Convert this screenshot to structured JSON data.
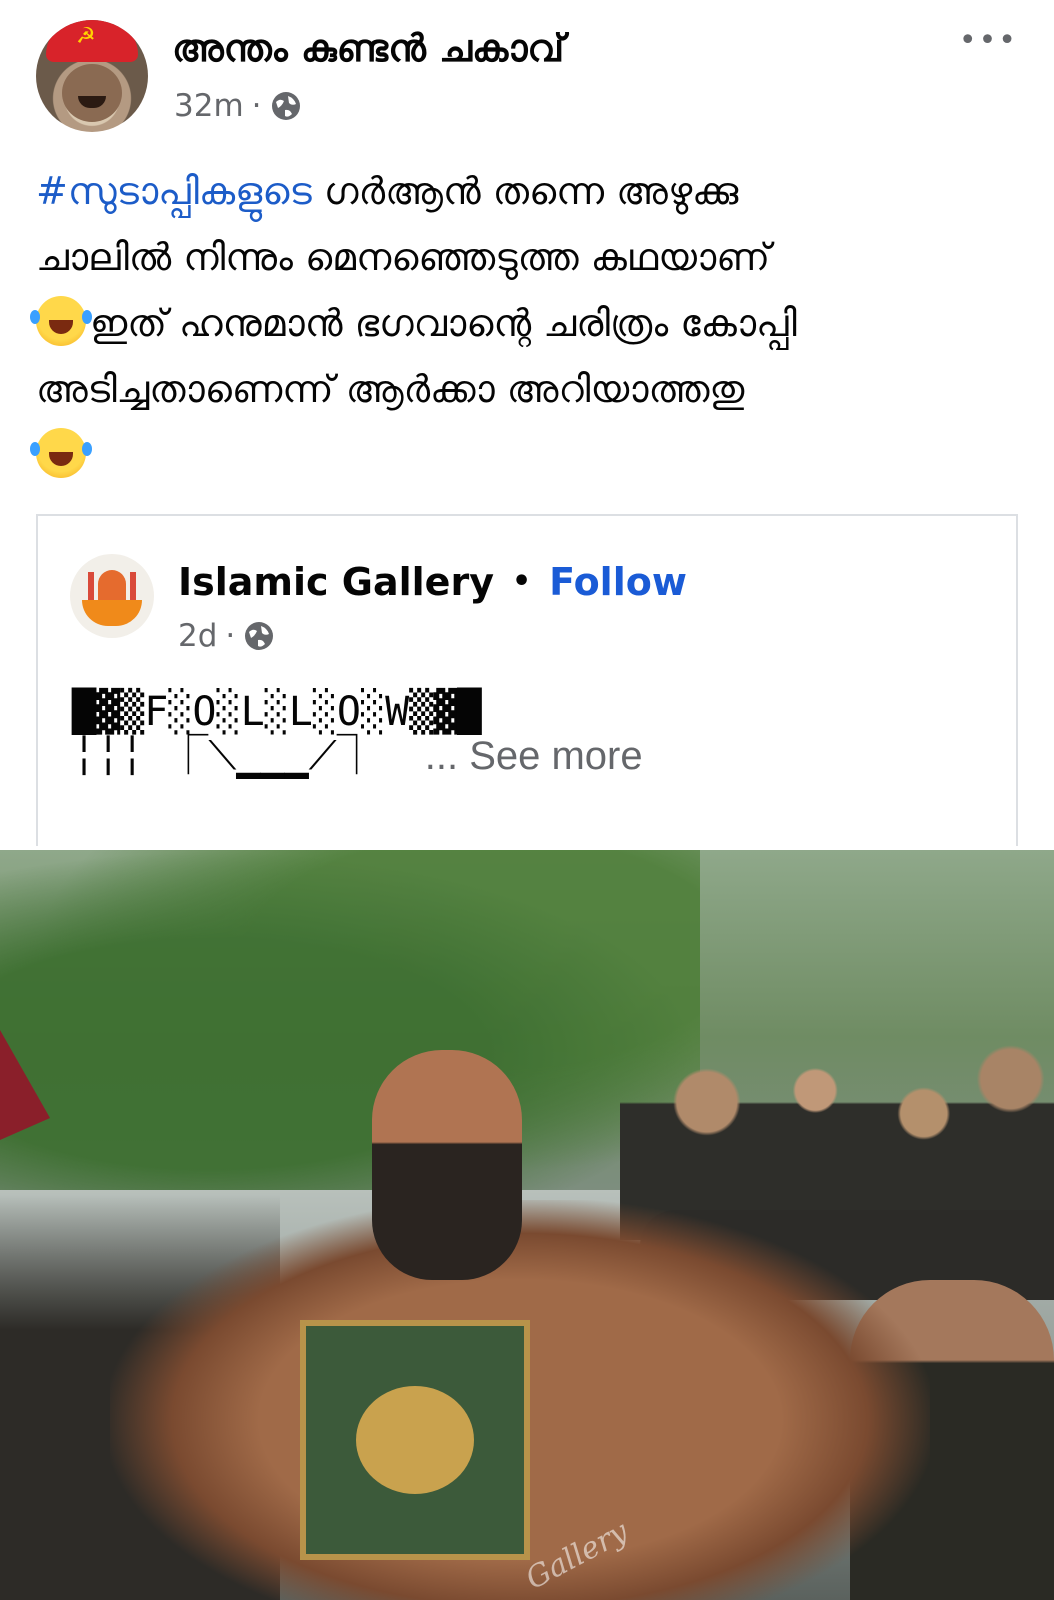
{
  "post": {
    "author": "അന്തം കുണ്ടൻ ചകാവ്",
    "time": "32m",
    "separator": "·",
    "privacy_icon": "globe-icon",
    "more_icon": "ellipsis-icon",
    "more_label": "•••",
    "text": {
      "hashtag": "#സുടാപ്പികളുടെ",
      "line1_rest": " ഗർആൻ തന്നെ അഴുക്കു",
      "line2": "ചാലിൽ നിന്നും മെനഞ്ഞെടുത്ത കഥയാണ്",
      "line3": "ഇത് ഹനുമാൻ ഭഗവാന്റെ ചരിത്രം കോപ്പി",
      "line4": "അടിച്ചതാണെന്ന് ആർക്കാ അറിയാത്തതു",
      "emoji": "rolling-on-floor-laughing"
    }
  },
  "shared": {
    "page_name": "Islamic Gallery",
    "dot": "•",
    "follow_label": "Follow",
    "time": "2d",
    "separator": "·",
    "body_line1": "█▓▒F░O░L░L░O░W▒▓█",
    "body_line2": "╎╎╎ ⎾⟍▁▁▁⟋⏋",
    "see_more": "... See more"
  },
  "image": {
    "alt": "Illustrated image of a muscular bearded man tearing open his shirt revealing a Quran on his chest, with men in a boat behind",
    "watermark": "Gallery"
  }
}
